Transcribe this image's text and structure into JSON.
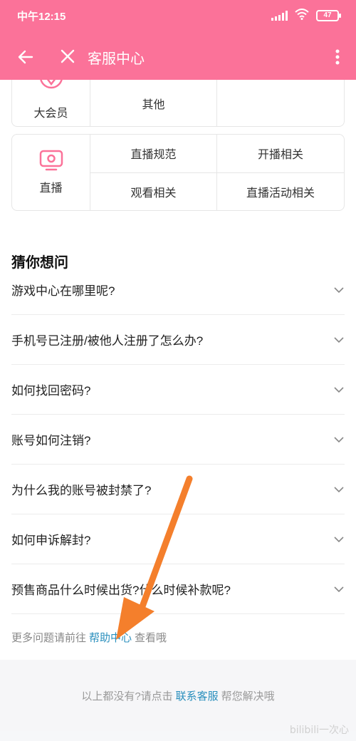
{
  "status_bar": {
    "time": "中午12:15",
    "battery": "47"
  },
  "app_bar": {
    "title": "客服中心"
  },
  "categories": [
    {
      "name": "大会员",
      "icon": "vip-icon",
      "items": [
        "其他",
        ""
      ]
    },
    {
      "name": "直播",
      "icon": "live-tv-icon",
      "items": [
        "直播规范",
        "开播相关",
        "观看相关",
        "直播活动相关"
      ]
    }
  ],
  "faq": {
    "title": "猜你想问",
    "items": [
      "游戏中心在哪里呢?",
      "手机号已注册/被他人注册了怎么办?",
      "如何找回密码?",
      "账号如何注销?",
      "为什么我的账号被封禁了?",
      "如何申诉解封?",
      "预售商品什么时候出货?什么时候补款呢?"
    ],
    "more_prefix": "更多问题请前往",
    "more_link": "帮助中心",
    "more_suffix": "查看哦"
  },
  "bottom": {
    "prefix": "以上都没有?请点击",
    "link": "联系客服",
    "suffix": "帮您解决哦"
  },
  "watermark": "bilibili一次心",
  "colors": {
    "brand_pink": "#fb7299",
    "link_blue": "#2a8fbd",
    "annotation_arrow": "#f47f2c"
  }
}
